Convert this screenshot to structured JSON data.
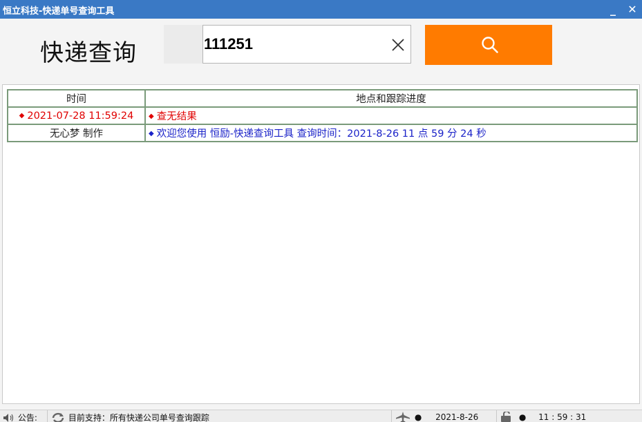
{
  "window": {
    "title": "恒立科技-快递单号查询工具",
    "minimize_label": "_",
    "close_label": "✕"
  },
  "header": {
    "app_title": "快递查询",
    "tracking_input_value": "111251",
    "search_icon": "magnifier-icon",
    "clear_icon": "x-icon",
    "accent_color": "#ff7b00"
  },
  "results": {
    "columns": [
      "时间",
      "地点和跟踪进度"
    ],
    "rows": [
      {
        "time": "2021-07-28 11:59:24",
        "detail": "查无结果",
        "color": "#e00000"
      },
      {
        "time": "无心梦 制作",
        "detail": "欢迎您使用 恒励-快递查询工具  查询时间：2021-8-26   11 点 59 分 24 秒",
        "color": "#1a22c8"
      }
    ]
  },
  "statusbar": {
    "notice_label": "公告:",
    "support_text": "目前支持：所有快递公司单号查询跟踪",
    "date": "2021-8-26",
    "time": "11 : 59 : 31"
  }
}
